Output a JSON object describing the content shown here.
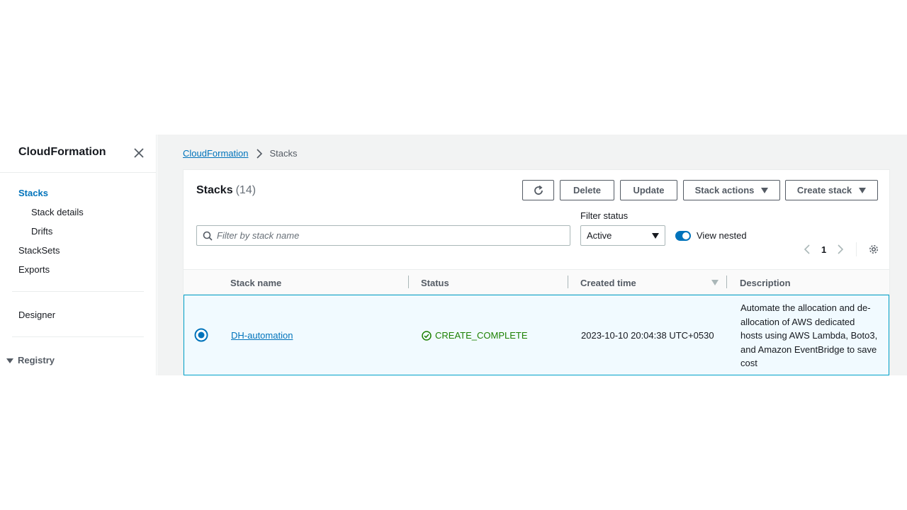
{
  "sidebar": {
    "title": "CloudFormation",
    "items": [
      {
        "label": "Stacks"
      },
      {
        "label": "Stack details"
      },
      {
        "label": "Drifts"
      },
      {
        "label": "StackSets"
      },
      {
        "label": "Exports"
      },
      {
        "label": "Designer"
      }
    ],
    "registry_label": "Registry"
  },
  "breadcrumb": {
    "root": "CloudFormation",
    "current": "Stacks"
  },
  "panel": {
    "title": "Stacks",
    "count": "(14)",
    "buttons": {
      "delete": "Delete",
      "update": "Update",
      "stack_actions": "Stack actions",
      "create_stack": "Create stack"
    },
    "search": {
      "placeholder": "Filter by stack name",
      "value": ""
    },
    "filter_status": {
      "label": "Filter status",
      "selected": "Active"
    },
    "view_nested": {
      "label": "View nested",
      "on": true
    },
    "pagination": {
      "page": "1"
    }
  },
  "table": {
    "columns": [
      "Stack name",
      "Status",
      "Created time",
      "Description"
    ],
    "rows": [
      {
        "selected": true,
        "stack_name": "DH-automation",
        "status": "CREATE_COMPLETE",
        "created_time": "2023-10-10 20:04:38 UTC+0530",
        "description": "Automate the allocation and de-allocation of AWS dedicated hosts using AWS Lambda, Boto3, and Amazon EventBridge to save cost"
      }
    ]
  },
  "colors": {
    "link": "#0073bb",
    "success": "#1d8102",
    "selected_row_bg": "#f1faff",
    "selected_row_border": "#00a1c9",
    "page_bg": "#f2f3f3"
  },
  "icons": [
    "close-icon",
    "chevron-right-icon",
    "refresh-icon",
    "caret-down-icon",
    "search-icon",
    "chevron-left-icon",
    "gear-icon",
    "sort-down-icon",
    "check-circle-icon",
    "radio-selected-icon"
  ]
}
